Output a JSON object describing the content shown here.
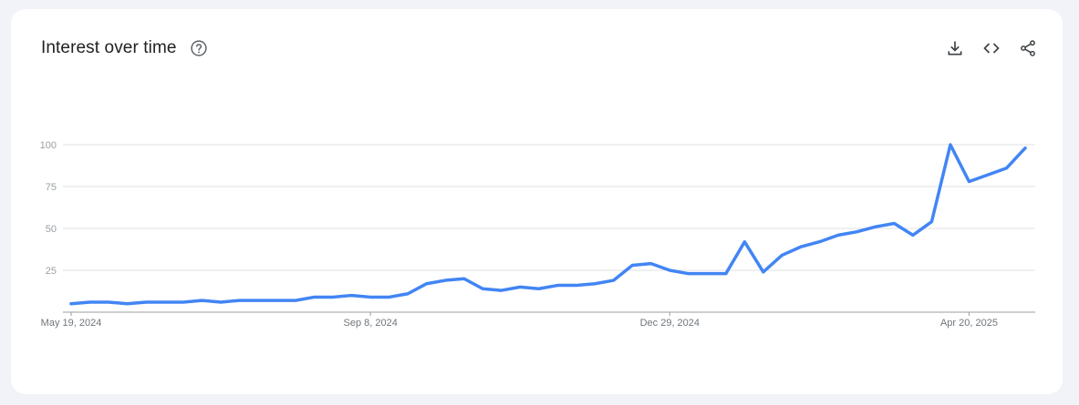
{
  "card": {
    "title": "Interest over time"
  },
  "icons": {
    "help": "help-circle-icon",
    "download": "download-icon",
    "embed": "embed-code-icon",
    "share": "share-icon"
  },
  "colors": {
    "line": "#4285f4",
    "grid": "#e0e0e0",
    "axis": "#9e9e9e"
  },
  "chart_data": {
    "type": "line",
    "title": "Interest over time",
    "xlabel": "",
    "ylabel": "",
    "ylim": [
      0,
      100
    ],
    "yticks": [
      25,
      50,
      75,
      100
    ],
    "ytick_labels": [
      "25",
      "50",
      "75",
      "100"
    ],
    "xtick_labels": [
      "May 19, 2024",
      "Sep 8, 2024",
      "Dec 29, 2024",
      "Apr 20, 2025"
    ],
    "xtick_index": [
      0,
      16,
      32,
      48
    ],
    "grid": true,
    "legend": "none",
    "series": [
      {
        "values": [
          5,
          6,
          6,
          5,
          6,
          6,
          6,
          7,
          6,
          7,
          7,
          7,
          7,
          9,
          9,
          10,
          9,
          9,
          11,
          17,
          19,
          20,
          14,
          13,
          15,
          14,
          16,
          16,
          17,
          19,
          28,
          29,
          25,
          23,
          23,
          23,
          42,
          24,
          34,
          39,
          42,
          46,
          48,
          51,
          53,
          46,
          54,
          100,
          78,
          82,
          86,
          98
        ]
      }
    ]
  }
}
